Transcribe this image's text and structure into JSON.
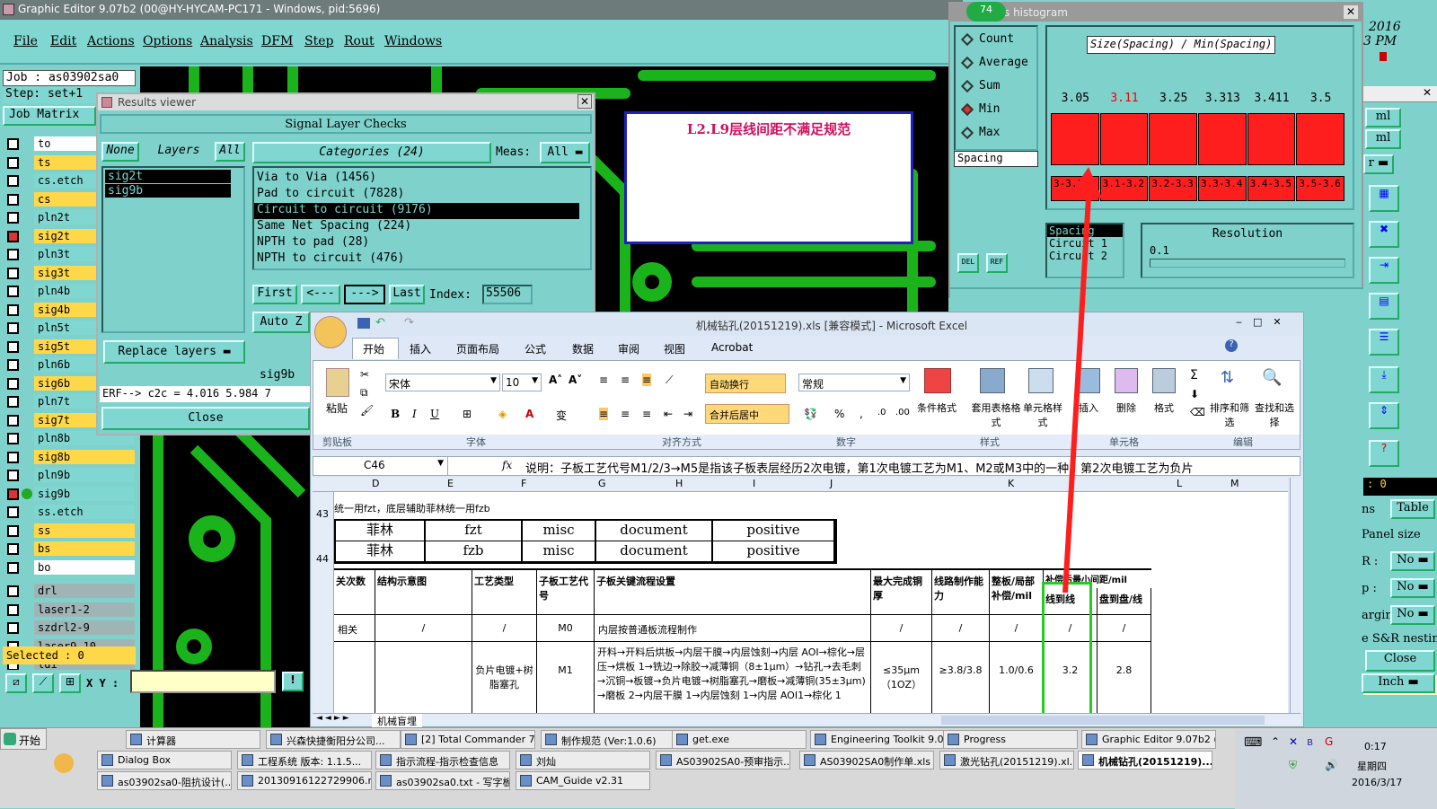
{
  "title_bar": "Graphic Editor 9.07b2 (00@HY-HYCAM-PC171 - Windows, pid:5696)",
  "menu": [
    "File",
    "Edit",
    "Actions",
    "Options",
    "Analysis",
    "DFM",
    "Step",
    "Rout",
    "Windows"
  ],
  "job_label": "Job : as03902sa0",
  "step_label": "Step: set+1",
  "job_matrix": "Job Matrix",
  "layers": [
    "to",
    "ts",
    "cs.etch",
    "cs",
    "pln2t",
    "sig2t",
    "pln3t",
    "sig3t",
    "pln4b",
    "sig4b",
    "pln5t",
    "sig5t",
    "pln6b",
    "sig6b",
    "pln7t",
    "sig7t",
    "pln8b",
    "sig8b",
    "pln9b",
    "sig9b",
    "ss.etch",
    "ss",
    "bs",
    "bo",
    "drl",
    "laser1-2",
    "szdrl2-9",
    "laser9-10",
    "ldi"
  ],
  "selected": "Selected : 0",
  "xy_label": "X Y :",
  "results_viewer": {
    "title": "Results viewer",
    "header": "Signal Layer Checks",
    "none_btn": "None",
    "layers_label": "Layers",
    "all_btn": "All",
    "categories_label": "Categories (24)",
    "meas_label": "Meas:",
    "meas_value": "All",
    "layer_items": [
      "sig2t",
      "sig9b"
    ],
    "categories": [
      "Via to Via (1456)",
      "Pad to circuit (7828)",
      "Circuit to circuit (9176)",
      "Same Net Spacing (224)",
      "NPTH to pad (28)",
      "NPTH to circuit (476)"
    ],
    "first": "First",
    "prev": "<---",
    "next": "--->",
    "last": "Last",
    "index_label": "Index:",
    "index_value": "55506",
    "auto_z": "Auto Z",
    "replace_layers": "Replace layers",
    "current_layer": "sig9b",
    "erf_line": "ERF--> c2c = 4.016 5.984 7",
    "close": "Close"
  },
  "annotation_box": "L2.L9层线间距不满足规范",
  "histogram": {
    "badge": "74",
    "title": "s histogram",
    "options": [
      "Count",
      "Average",
      "Sum",
      "Min",
      "Max"
    ],
    "selected_option": "Min",
    "spacing_field": "Spacing",
    "title_box": "Size(Spacing) / Min(Spacing)",
    "chart_labels": [
      "3.05",
      "3.11",
      "3.25",
      "3.313",
      "3.411",
      "3.5"
    ],
    "ranges": [
      "3-3.1",
      "3.1-3.2",
      "3.2-3.3",
      "3.3-3.4",
      "3.4-3.5",
      "3.5-3.6"
    ],
    "list_items": [
      "Spacing",
      "Circuit 1",
      "Circuit 2"
    ],
    "resolution_label": "Resolution",
    "resolution_value": "0.1",
    "del_btn": "DEL",
    "ref_btn": "REF"
  },
  "right_strip": {
    "date_top": "2016",
    "time_top": "3 PM",
    "ml1": "ml",
    "ml2": "ml",
    "r_label": "r",
    "coord": ": 0",
    "ns": "ns",
    "table": "Table",
    "panel_size": "Panel size",
    "r_row": "R :",
    "p_row": "p :",
    "margin_row": "argin:",
    "no1": "No",
    "no2": "No",
    "no3": "No",
    "nesting": "e S&R nesting",
    "close": "Close",
    "inch": "Inch"
  },
  "excel": {
    "title": "机械钻孔(20151219).xls  [兼容模式] - Microsoft Excel",
    "tabs": [
      "开始",
      "插入",
      "页面布局",
      "公式",
      "数据",
      "审阅",
      "视图",
      "Acrobat"
    ],
    "font_name": "宋体",
    "font_size": "10",
    "number_format": "常规",
    "wrap_text": "自动换行",
    "merge_center": "合并后居中",
    "groups": [
      "剪贴板",
      "字体",
      "对齐方式",
      "数字",
      "样式",
      "单元格",
      "编辑"
    ],
    "paste": "粘贴",
    "cond_format": "条件格式",
    "table_format": "套用表格格式",
    "cell_style": "单元格样式",
    "insert": "插入",
    "delete": "删除",
    "format": "格式",
    "sort_filter": "排序和筛选",
    "find_select": "查找和选择",
    "name_box": "C46",
    "formula": "说明：子板工艺代号M1/2/3→M5是指该子板表层经历2次电镀，第1次电镀工艺为M1、M2或M3中的一种，第2次电镀工艺为负片",
    "columns": [
      "D",
      "E",
      "F",
      "G",
      "H",
      "I",
      "J",
      "K",
      "L",
      "M"
    ],
    "row43_text": "统一用fzt，底层辅助菲林统一用fzb",
    "row_nums": [
      "43",
      "44"
    ],
    "film_rows": [
      [
        "菲林",
        "fzt",
        "misc",
        "document",
        "positive"
      ],
      [
        "菲林",
        "fzb",
        "misc",
        "document",
        "positive"
      ]
    ],
    "table_headers": [
      "关次数",
      "结构示意图",
      "工艺类型",
      "子板工艺代号",
      "子板关键流程设置",
      "最大完成铜厚",
      "线路制作能力",
      "整板/局部补偿/mil",
      "补偿后最小间距/mil",
      "线到线",
      "盘到盘/线"
    ],
    "row_a": [
      "相关",
      "/",
      "/",
      "M0",
      "内层按普通板流程制作",
      "/",
      "/",
      "/",
      "/",
      "/"
    ],
    "row_b_type": "负片电镀+树脂塞孔",
    "row_b_code": "M1",
    "row_b_flow": "开料→开料后烘板→内层干膜→内层蚀刻→内层 AOI→棕化→层压→烘板 1→铣边→除胶→减薄铜（8±1μm）→钻孔→去毛刺→沉铜→板镀→负片电镀→树脂塞孔→磨板→减薄铜(35±3μm) →磨板 2→内层干膜 1→内层蚀刻 1→内层 AOI1→棕化 1",
    "row_b_copper": "≤35μm（1OZ）",
    "row_b_line": "≥3.8/3.8",
    "row_b_comp": "1.0/0.6",
    "row_b_l2l": "3.2",
    "row_b_p2p": "2.8",
    "sheet_tab": "机械盲埋"
  },
  "taskbar": {
    "start": "开始",
    "row1": [
      "计算器",
      "兴森快捷衡阳分公司...",
      "[2] Total Commander 7...",
      "制作规范 (Ver:1.0.6)",
      "get.exe",
      "Engineering Toolkit 9.0...",
      "Progress",
      "Graphic Editor 9.07b2 (..."
    ],
    "row2": [
      "Dialog Box",
      "工程系统  版本: 1.1.5...",
      "指示流程-指示检查信息",
      "刘灿",
      "AS03902SA0-预审指示....",
      "AS03902SA0制作单.xls ...",
      "激光钻孔(20151219).xl...",
      "机械钻孔(20151219)...."
    ],
    "row3": [
      "as03902sa0-阻抗设计(...",
      "20130916122729906.rtf...",
      "as03902sa0.txt - 写字板",
      "CAM_Guide v2.31"
    ],
    "clock_time": "0:17",
    "clock_day": "星期四",
    "clock_date": "2016/3/17"
  },
  "colors": {
    "teal": "#7fd2cc",
    "yellow": "#ffd84a",
    "red": "#ff1e1e",
    "green_trace": "#1bb31b",
    "highlight_green": "#22cc22"
  }
}
